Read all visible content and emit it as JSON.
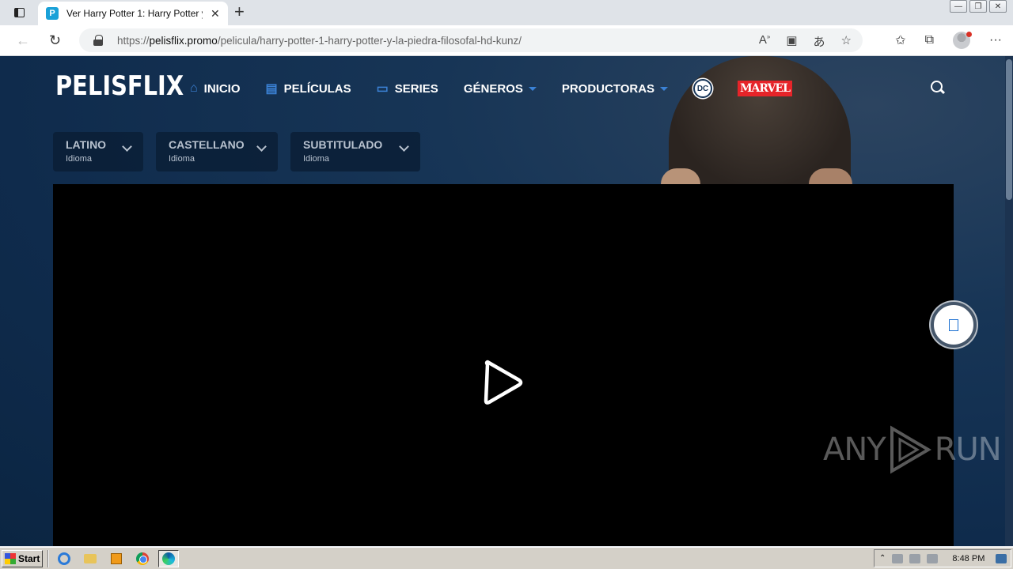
{
  "browser": {
    "tab_title": "Ver Harry Potter 1: Harry Potter y",
    "favicon_letter": "P",
    "url_scheme": "https://",
    "url_host": "pelisflix.promo",
    "url_path": "/pelicula/harry-potter-1-harry-potter-y-la-piedra-filosofal-hd-kunz/",
    "window_buttons": [
      "—",
      "❐",
      "✕"
    ]
  },
  "site": {
    "logo": "PELISFLIX",
    "nav": [
      {
        "label": "INICIO",
        "icon": "home-icon"
      },
      {
        "label": "PELÍCULAS",
        "icon": "film-icon"
      },
      {
        "label": "SERIES",
        "icon": "tv-icon"
      },
      {
        "label": "GÉNEROS",
        "icon": "chevron-down-icon"
      },
      {
        "label": "PRODUCTORAS",
        "icon": "chevron-down-icon"
      }
    ],
    "dc_label": "DC",
    "marvel_label": "MARVEL",
    "languages": [
      {
        "name": "LATINO",
        "sub": "Idioma"
      },
      {
        "name": "CASTELLANO",
        "sub": "Idioma"
      },
      {
        "name": "SUBTITULADO",
        "sub": "Idioma"
      }
    ],
    "accent_color": "#3b82d6"
  },
  "watermark": {
    "left": "ANY",
    "right": "RUN"
  },
  "taskbar": {
    "start_label": "Start",
    "clock": "8:48 PM"
  }
}
